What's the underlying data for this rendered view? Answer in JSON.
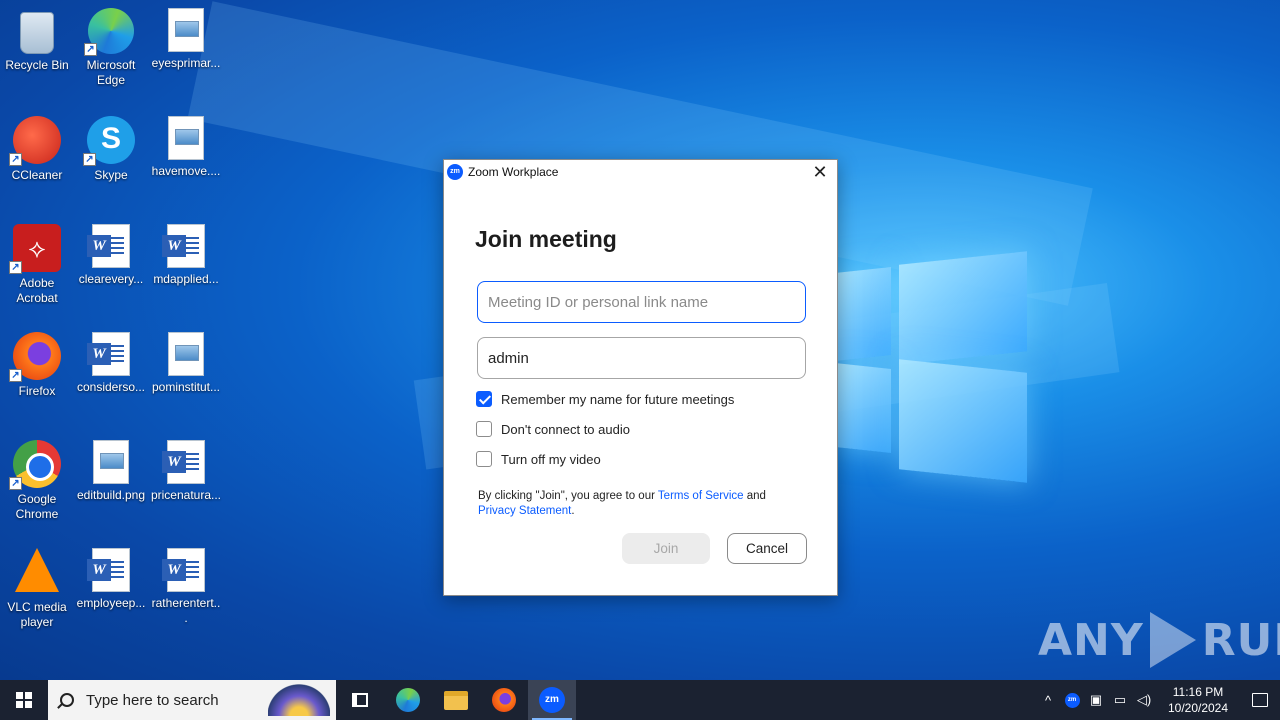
{
  "desktop": {
    "icons": [
      {
        "label": "Recycle Bin"
      },
      {
        "label": "Microsoft Edge"
      },
      {
        "label": "eyesprimar..."
      },
      {
        "label": "CCleaner"
      },
      {
        "label": "Skype"
      },
      {
        "label": "havemove...."
      },
      {
        "label": "Adobe Acrobat"
      },
      {
        "label": "clearevery..."
      },
      {
        "label": "mdapplied..."
      },
      {
        "label": "Firefox"
      },
      {
        "label": "considerso..."
      },
      {
        "label": "pominstitut..."
      },
      {
        "label": "Google Chrome"
      },
      {
        "label": "editbuild.png"
      },
      {
        "label": "pricenatura..."
      },
      {
        "label": "VLC media player"
      },
      {
        "label": "employeep..."
      },
      {
        "label": "ratherentert..."
      }
    ]
  },
  "dialog": {
    "title": "Zoom Workplace",
    "logo_text": "zm",
    "close_glyph": "✕",
    "heading": "Join meeting",
    "meeting_id": {
      "value": "",
      "placeholder": "Meeting ID or personal link name"
    },
    "name": {
      "value": "admin"
    },
    "options": [
      {
        "label": "Remember my name for future meetings",
        "checked": true
      },
      {
        "label": "Don't connect to audio",
        "checked": false
      },
      {
        "label": "Turn off my video",
        "checked": false
      }
    ],
    "terms": {
      "prefix": "By clicking \"Join\", you agree to our ",
      "tos_link": "Terms of Service",
      "middle": " and",
      "privacy_link": "Privacy Statement",
      "suffix": "."
    },
    "join_label": "Join",
    "cancel_label": "Cancel"
  },
  "watermark": {
    "left": "ANY",
    "right": "RUN"
  },
  "taskbar": {
    "search_placeholder": "Type here to search",
    "pinned": [
      "task-view-icon",
      "edge-icon",
      "file-explorer-icon",
      "firefox-icon",
      "zoom-icon"
    ],
    "active": "zoom-icon",
    "tray": {
      "chevron": "^",
      "zoom": "zm"
    },
    "time": "11:16 PM",
    "date": "10/20/2024"
  },
  "colors": {
    "zoom_blue": "#0b5cff",
    "taskbar": "#1b2231"
  }
}
